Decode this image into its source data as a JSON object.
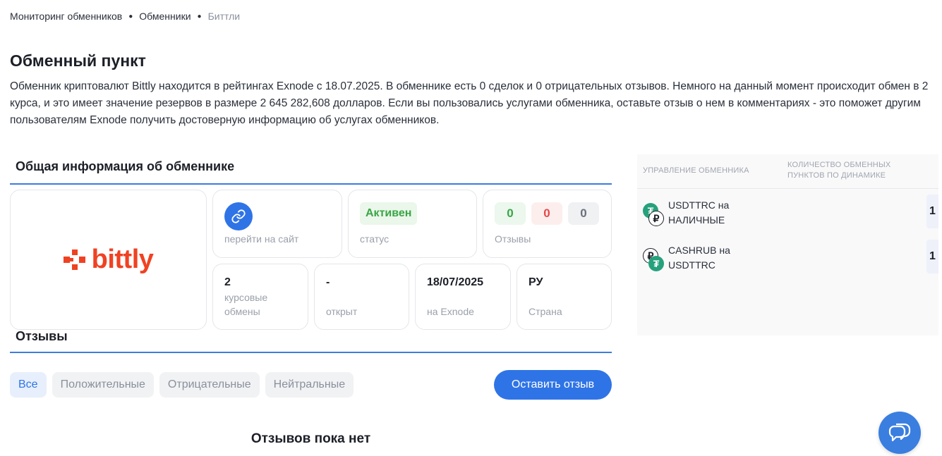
{
  "breadcrumb": {
    "items": [
      "Мониторинг обменников",
      "Обменники",
      "Биттли"
    ]
  },
  "page": {
    "title": "Обменный пункт",
    "intro": "Обменник криптовалют Bittly находится в рейтингах Exnode с 18.07.2025. В обменнике есть 0 сделок и 0 отрицательных отзывов. Немного на данный момент происходит обмен в 2 курса, и это имеет значение резервов в размере 2 645 282,608 долларов. Если вы пользовались услугами обменника, оставьте отзыв о нем в комментариях - это поможет другим пользователям Exnode получить достоверную информацию об услугах обменников."
  },
  "general": {
    "title": "Общая информация об обменнике",
    "logo_text": "bittly",
    "brand_color": "#ef4223",
    "site_label": "перейти на сайт",
    "status_value": "Активен",
    "status_label": "статус",
    "reviews": {
      "positive": "0",
      "negative": "0",
      "neutral": "0",
      "label": "Отзывы"
    },
    "stats": {
      "rates": {
        "value": "2",
        "label": "курсовые обмены"
      },
      "opened": {
        "value": "-",
        "label": "открыт"
      },
      "exnode": {
        "value": "18/07/2025",
        "label": "на Exnode"
      },
      "country": {
        "value": "РУ",
        "label": "Страна"
      }
    }
  },
  "reviews": {
    "title": "Отзывы",
    "filters": [
      "Все",
      "Положительные",
      "Отрицательные",
      "Нейтральные"
    ],
    "active_filter": "Все",
    "leave_review_label": "Оставить отзыв",
    "empty_text": "Отзывов пока нет"
  },
  "side_panel": {
    "col1": "УПРАВЛЕНИЕ ОБМЕННИКА",
    "col2": "КОЛИЧЕСТВО ОБМЕННЫХ ПУНКТОВ ПО ДИНАМИКЕ",
    "rows": [
      {
        "label": "USDTTRC на НАЛИЧНЫЕ",
        "from_icon": "tether-icon",
        "to_icon": "ruble-icon",
        "count": "1"
      },
      {
        "label": "CASHRUB на USDTTRC",
        "from_icon": "ruble-icon",
        "to_icon": "tether-icon",
        "count": "1"
      }
    ]
  },
  "colors": {
    "accent": "#2f74e6",
    "positive": "#3aa546",
    "negative": "#e54848",
    "tether": "#26a17b"
  },
  "icons": {
    "link": "link-icon",
    "chat": "chat-icon"
  }
}
